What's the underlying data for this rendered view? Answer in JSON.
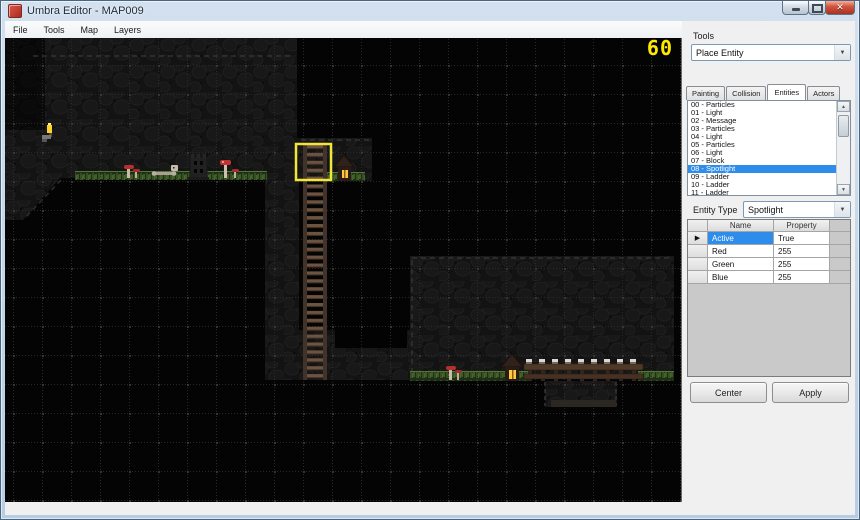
{
  "window": {
    "title": "Umbra Editor - MAP009",
    "controls": {
      "minimize_icon": "minimize",
      "maximize_icon": "maximize",
      "close_icon": "✕"
    }
  },
  "menu": {
    "items": [
      "File",
      "Tools",
      "Map",
      "Layers"
    ]
  },
  "tools_panel": {
    "label": "Tools",
    "selected_tool": "Place Entity",
    "dropdown_arrow_icon": "▼"
  },
  "tabs": {
    "items": [
      "Painting",
      "Collision",
      "Entities",
      "Actors"
    ],
    "active": "Entities",
    "active_index": 2
  },
  "entity_list": {
    "items": [
      "00 - Particles",
      "01 - Light",
      "02 - Message",
      "03 - Particles",
      "04 - Light",
      "05 - Particles",
      "06 - Light",
      "07 - Block",
      "08 - Spotlight",
      "09 - Ladder",
      "10 - Ladder",
      "11 - Ladder"
    ],
    "selected_index": 8,
    "scroll_up_icon": "▲",
    "scroll_down_icon": "▼"
  },
  "entity_type": {
    "label": "Entity Type",
    "value": "Spotlight",
    "dropdown_arrow_icon": "▼"
  },
  "properties": {
    "columns": [
      "Name",
      "Property"
    ],
    "rows": [
      {
        "name": "Active",
        "value": "True"
      },
      {
        "name": "Red",
        "value": "255"
      },
      {
        "name": "Green",
        "value": "255"
      },
      {
        "name": "Blue",
        "value": "255"
      }
    ],
    "selected_row": 0,
    "row_marker_icon": "▶"
  },
  "buttons": {
    "center": "Center",
    "apply": "Apply"
  },
  "map": {
    "fps_counter": "60",
    "objects": [
      "torch",
      "mushrooms",
      "bones",
      "tower",
      "shrine-lantern",
      "ladder",
      "bridge",
      "spotlight-selection"
    ],
    "colors": {
      "selection_yellow": "#f2e63a",
      "fps_yellow": "#ffe800",
      "list_selection_blue": "#2e8ceb",
      "grass_green": "#3f5c28",
      "mushroom_red": "#b52f2f",
      "lantern_glow": "#ffc83e",
      "ladder_brown": "#6e5340"
    }
  }
}
